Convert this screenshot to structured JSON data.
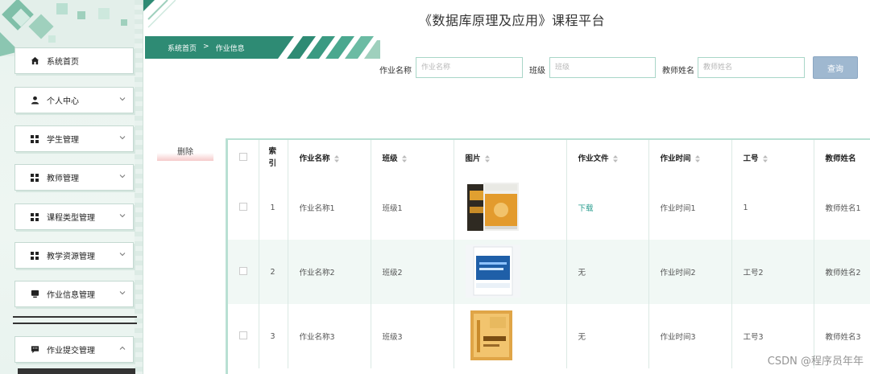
{
  "header": {
    "title": "《数据库原理及应用》课程平台"
  },
  "breadcrumb": {
    "home": "系统首页",
    "separator": ">",
    "current": "作业信息"
  },
  "sidebar": {
    "items": [
      {
        "label": "系统首页",
        "icon": "home-icon",
        "has_chevron": false
      },
      {
        "label": "个人中心",
        "icon": "user-icon",
        "has_chevron": true
      },
      {
        "label": "学生管理",
        "icon": "grid-icon",
        "has_chevron": true
      },
      {
        "label": "教师管理",
        "icon": "grid-icon",
        "has_chevron": true
      },
      {
        "label": "课程类型管理",
        "icon": "grid-icon",
        "has_chevron": true
      },
      {
        "label": "教学资源管理",
        "icon": "grid-icon",
        "has_chevron": true
      },
      {
        "label": "作业信息管理",
        "icon": "monitor-icon",
        "has_chevron": true
      },
      {
        "label": "作业提交管理",
        "icon": "chat-icon",
        "has_chevron": true,
        "expanded": true
      }
    ]
  },
  "search": {
    "fields": [
      {
        "label": "作业名称",
        "placeholder": "作业名称"
      },
      {
        "label": "班级",
        "placeholder": "班级"
      },
      {
        "label": "教师姓名",
        "placeholder": "教师姓名"
      }
    ],
    "query_label": "查询"
  },
  "actions": {
    "delete_label": "删除"
  },
  "table": {
    "columns": [
      "",
      "索引",
      "作业名称",
      "班级",
      "图片",
      "作业文件",
      "作业时间",
      "工号",
      "教师姓名"
    ],
    "rows": [
      {
        "index": "1",
        "name": "作业名称1",
        "class": "班级1",
        "file": "下载",
        "file_is_link": true,
        "time": "作业时间1",
        "job_no": "1",
        "teacher": "教师姓名1"
      },
      {
        "index": "2",
        "name": "作业名称2",
        "class": "班级2",
        "file": "无",
        "file_is_link": false,
        "time": "作业时间2",
        "job_no": "工号2",
        "teacher": "教师姓名2"
      },
      {
        "index": "3",
        "name": "作业名称3",
        "class": "班级3",
        "file": "无",
        "file_is_link": false,
        "time": "作业时间3",
        "job_no": "工号3",
        "teacher": "教师姓名3"
      }
    ]
  },
  "watermark": "CSDN @程序员年年",
  "colors": {
    "accent": "#2e8b74",
    "sidebar_bg": "#e9f3ef",
    "table_border": "#b9e0d3",
    "row_highlight": "#f1f8f5",
    "query_button": "#9fb8d0",
    "link": "#2a9d8f"
  }
}
